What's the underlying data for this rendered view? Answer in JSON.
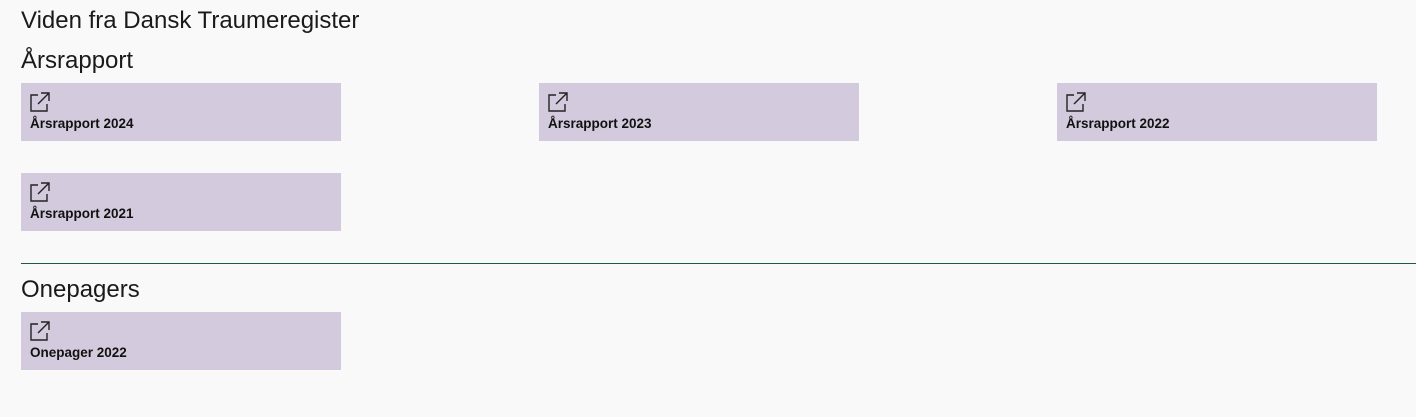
{
  "header": {
    "title": "Viden fra Dansk Traumeregister"
  },
  "sections": [
    {
      "title": "Årsrapport",
      "cards": [
        {
          "label": "Årsrapport 2024",
          "icon": "external-link-icon"
        },
        {
          "label": "Årsrapport 2023",
          "icon": "external-link-icon"
        },
        {
          "label": "Årsrapport 2022",
          "icon": "external-link-icon"
        },
        {
          "label": "Årsrapport 2021",
          "icon": "external-link-icon"
        }
      ]
    },
    {
      "title": "Onepagers",
      "cards": [
        {
          "label": "Onepager 2022",
          "icon": "external-link-icon"
        }
      ]
    }
  ],
  "colors": {
    "card_background": "#d4cadd",
    "divider": "#1f5b3f",
    "page_background": "#f9f9f9"
  }
}
